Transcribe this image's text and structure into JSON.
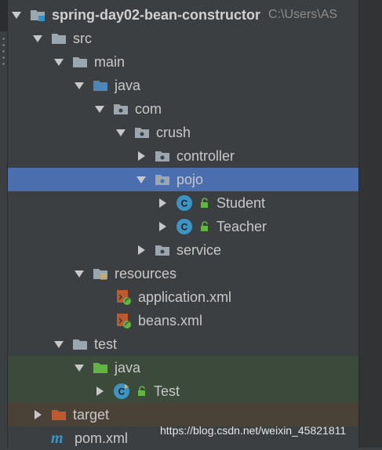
{
  "project": {
    "name": "spring-day02-bean-constructor",
    "path": "C:\\Users\\AS"
  },
  "tree": {
    "src": "src",
    "main": "main",
    "java": "java",
    "com": "com",
    "crush": "crush",
    "controller": "controller",
    "pojo": "pojo",
    "student": "Student",
    "teacher": "Teacher",
    "service": "service",
    "resources": "resources",
    "application_xml": "application.xml",
    "beans_xml": "beans.xml",
    "test": "test",
    "test_java": "java",
    "test_class": "Test",
    "target": "target",
    "pom_xml": "pom.xml"
  },
  "class_badge": "C",
  "pom_badge": "m",
  "selected_item": "pojo",
  "watermark": "https://blog.csdn.net/weixin_45821811",
  "colors": {
    "background": "#3c3f41",
    "selection": "#4b6eaf",
    "test_highlight": "#3b4a3b",
    "target_highlight": "#4a4237",
    "folder": "#9aa7b0",
    "source_folder": "#4a86b8",
    "test_folder": "#62b543",
    "excluded_folder": "#c05a2e",
    "class_icon": "#3a95c4"
  }
}
